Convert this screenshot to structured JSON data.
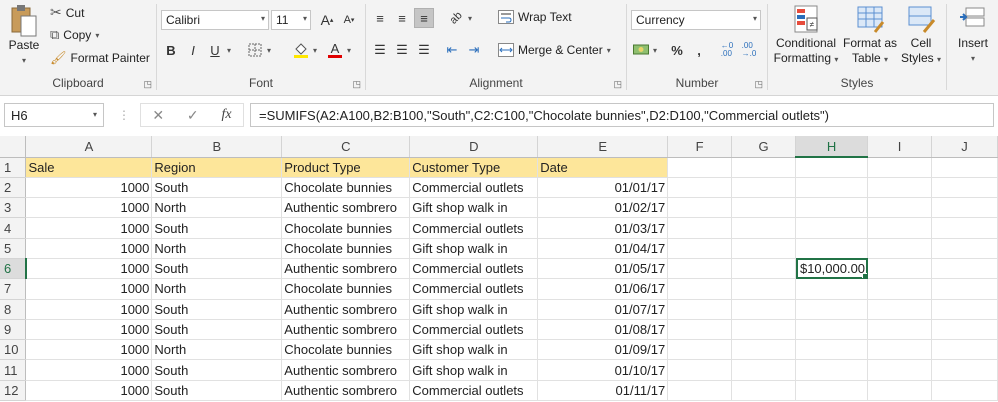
{
  "ribbon": {
    "clipboard": {
      "paste": "Paste",
      "cut": "Cut",
      "copy": "Copy",
      "format_painter": "Format Painter",
      "label": "Clipboard"
    },
    "font": {
      "font_name": "Calibri",
      "font_size": "11",
      "grow": "A",
      "shrink": "A",
      "bold": "B",
      "italic": "I",
      "underline": "U",
      "font_color_letter": "A",
      "label": "Font"
    },
    "alignment": {
      "wrap_text": "Wrap Text",
      "merge_center": "Merge & Center",
      "label": "Alignment"
    },
    "number": {
      "format": "Currency",
      "percent": "%",
      "comma": ",",
      "label": "Number"
    },
    "styles": {
      "conditional_formatting_1": "Conditional",
      "conditional_formatting_2": "Formatting",
      "format_as_table_1": "Format as",
      "format_as_table_2": "Table",
      "cell_styles_1": "Cell",
      "cell_styles_2": "Styles",
      "label": "Styles"
    },
    "cells": {
      "insert": "Insert"
    },
    "accent_color": "#217346"
  },
  "formula_bar": {
    "name_box": "H6",
    "formula": "=SUMIFS(A2:A100,B2:B100,\"South\",C2:C100,\"Chocolate bunnies\",D2:D100,\"Commercial outlets\")"
  },
  "sheet": {
    "columns": [
      "A",
      "B",
      "C",
      "D",
      "E",
      "F",
      "G",
      "H",
      "I",
      "J"
    ],
    "row_numbers": [
      "1",
      "2",
      "3",
      "4",
      "5",
      "6",
      "7",
      "8",
      "9",
      "10",
      "11",
      "12"
    ],
    "headers": [
      "Sale",
      "Region",
      "Product Type",
      "Customer Type",
      "Date"
    ],
    "rows": [
      [
        "1000",
        "South",
        "Chocolate bunnies",
        "Commercial outlets",
        "01/01/17"
      ],
      [
        "1000",
        "North",
        "Authentic sombrero",
        "Gift shop walk in",
        "01/02/17"
      ],
      [
        "1000",
        "South",
        "Chocolate bunnies",
        "Commercial outlets",
        "01/03/17"
      ],
      [
        "1000",
        "North",
        "Chocolate bunnies",
        "Gift shop walk in",
        "01/04/17"
      ],
      [
        "1000",
        "South",
        "Authentic sombrero",
        "Commercial outlets",
        "01/05/17"
      ],
      [
        "1000",
        "North",
        "Chocolate bunnies",
        "Commercial outlets",
        "01/06/17"
      ],
      [
        "1000",
        "South",
        "Authentic sombrero",
        "Gift shop walk in",
        "01/07/17"
      ],
      [
        "1000",
        "South",
        "Authentic sombrero",
        "Commercial outlets",
        "01/08/17"
      ],
      [
        "1000",
        "North",
        "Chocolate bunnies",
        "Gift shop walk in",
        "01/09/17"
      ],
      [
        "1000",
        "South",
        "Authentic sombrero",
        "Gift shop walk in",
        "01/10/17"
      ],
      [
        "1000",
        "South",
        "Authentic sombrero",
        "Commercial outlets",
        "01/11/17"
      ]
    ],
    "active_cell_value": "$10,000.00",
    "header_fill": "#fde69a"
  }
}
